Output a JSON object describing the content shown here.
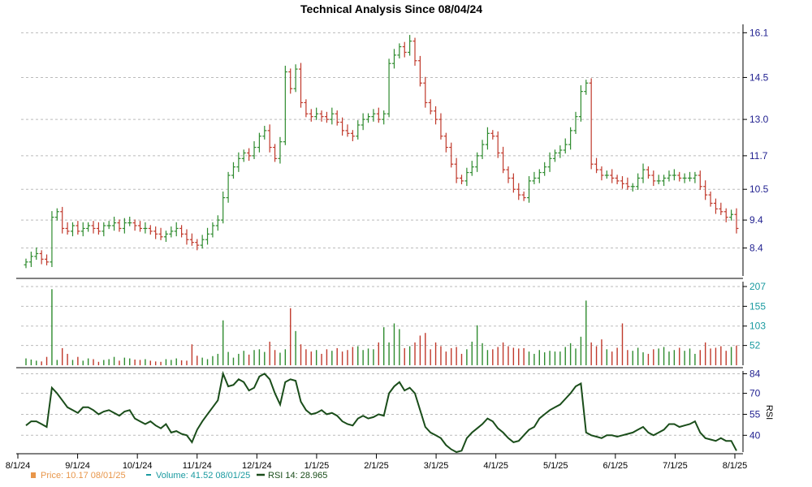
{
  "chart_data": {
    "type": "candlestick",
    "title": "Technical Analysis Since 08/04/24",
    "x_ticks": [
      "8/1/24",
      "9/1/24",
      "10/1/24",
      "11/1/24",
      "12/1/24",
      "1/1/25",
      "2/1/25",
      "3/1/25",
      "4/1/25",
      "5/1/25",
      "6/1/25",
      "7/1/25",
      "8/1/25"
    ],
    "price": {
      "yticks": [
        "16.1",
        "14.5",
        "13.0",
        "11.7",
        "10.5",
        "9.4",
        "8.4"
      ],
      "ylim": [
        7.4,
        16.4
      ],
      "close": [
        7.9,
        8.1,
        8.2,
        8.0,
        7.9,
        9.5,
        9.7,
        9.1,
        9.0,
        9.2,
        9.0,
        9.1,
        9.2,
        9.1,
        9.0,
        9.2,
        9.2,
        9.3,
        9.1,
        9.3,
        9.3,
        9.2,
        9.1,
        9.1,
        9.0,
        8.9,
        8.8,
        8.9,
        9.0,
        9.1,
        8.9,
        8.7,
        8.6,
        8.5,
        8.7,
        8.9,
        9.2,
        9.4,
        10.2,
        11.0,
        11.3,
        11.6,
        11.8,
        11.7,
        12.0,
        12.4,
        12.6,
        12.0,
        11.6,
        12.2,
        14.7,
        14.1,
        14.8,
        13.6,
        13.2,
        13.1,
        13.2,
        13.1,
        13.0,
        13.2,
        12.9,
        12.6,
        12.5,
        12.4,
        12.8,
        13.0,
        13.1,
        13.2,
        13.0,
        13.2,
        15.0,
        15.3,
        15.6,
        15.4,
        15.8,
        15.1,
        14.3,
        13.6,
        13.3,
        13.0,
        12.4,
        12.0,
        11.4,
        10.9,
        10.8,
        11.1,
        11.3,
        11.7,
        12.1,
        12.5,
        12.4,
        11.8,
        11.2,
        10.9,
        10.5,
        10.3,
        10.2,
        10.8,
        10.9,
        11.1,
        11.3,
        11.6,
        11.8,
        11.9,
        12.1,
        12.6,
        13.1,
        14.0,
        14.3,
        11.4,
        11.2,
        11.0,
        11.0,
        10.9,
        10.8,
        10.7,
        10.6,
        10.6,
        10.9,
        11.2,
        11.0,
        10.8,
        10.8,
        10.9,
        11.0,
        11.0,
        10.9,
        10.9,
        10.9,
        11.0,
        10.6,
        10.3,
        10.0,
        9.8,
        9.7,
        9.5,
        9.6,
        9.1
      ]
    },
    "volume": {
      "yticks": [
        "207",
        "155",
        "103",
        "52"
      ],
      "ylim": [
        0,
        207
      ],
      "values": [
        18,
        15,
        12,
        10,
        22,
        200,
        14,
        45,
        30,
        14,
        22,
        12,
        18,
        16,
        9,
        14,
        16,
        22,
        12,
        20,
        18,
        15,
        14,
        16,
        12,
        10,
        9,
        16,
        14,
        18,
        13,
        12,
        55,
        25,
        20,
        16,
        24,
        30,
        118,
        35,
        20,
        30,
        38,
        28,
        40,
        42,
        35,
        62,
        40,
        33,
        42,
        150,
        90,
        55,
        42,
        36,
        40,
        30,
        42,
        38,
        45,
        36,
        40,
        48,
        50,
        40,
        44,
        42,
        60,
        100,
        60,
        110,
        95,
        45,
        50,
        60,
        78,
        85,
        42,
        60,
        50,
        36,
        45,
        48,
        30,
        42,
        62,
        105,
        58,
        40,
        42,
        48,
        60,
        50,
        46,
        44,
        45,
        36,
        30,
        40,
        34,
        38,
        36,
        36,
        48,
        58,
        44,
        75,
        170,
        60,
        50,
        68,
        42,
        36,
        46,
        110,
        40,
        38,
        46,
        34,
        30,
        42,
        44,
        48,
        36,
        40,
        46,
        38,
        44,
        30,
        40,
        60,
        44,
        46,
        50,
        38,
        48,
        52
      ]
    },
    "rsi": {
      "yticks": [
        "84",
        "70",
        "55",
        "40"
      ],
      "ylim": [
        28,
        86
      ],
      "ylabel": "RSI",
      "values": [
        47,
        50,
        50,
        48,
        46,
        74,
        70,
        65,
        60,
        58,
        56,
        60,
        60,
        58,
        55,
        57,
        58,
        56,
        54,
        57,
        58,
        52,
        50,
        48,
        50,
        47,
        45,
        48,
        42,
        43,
        41,
        40,
        35,
        44,
        50,
        55,
        60,
        65,
        84,
        75,
        76,
        80,
        78,
        72,
        74,
        82,
        84,
        80,
        70,
        62,
        78,
        80,
        79,
        64,
        58,
        55,
        56,
        58,
        55,
        56,
        54,
        50,
        48,
        47,
        52,
        54,
        52,
        53,
        55,
        54,
        70,
        75,
        78,
        72,
        74,
        70,
        58,
        46,
        42,
        40,
        38,
        33,
        30,
        28,
        29,
        38,
        42,
        45,
        48,
        52,
        50,
        45,
        42,
        38,
        35,
        36,
        40,
        44,
        46,
        52,
        55,
        58,
        60,
        62,
        66,
        70,
        75,
        77,
        42,
        40,
        39,
        38,
        40,
        40,
        39,
        40,
        41,
        42,
        44,
        46,
        42,
        40,
        42,
        44,
        48,
        48,
        46,
        47,
        48,
        50,
        42,
        38,
        37,
        36,
        38,
        36,
        36,
        29
      ]
    },
    "legend": [
      {
        "label": "Price: 10.17  08/01/25",
        "color": "#e8964a",
        "symbol": "square"
      },
      {
        "label": "Volume: 41.52  08/01/25",
        "color": "#1a9aa0",
        "symbol": "dash"
      },
      {
        "label": "RSI 14: 28.965",
        "color": "#1a4d1a",
        "symbol": "line"
      }
    ],
    "colors": {
      "up": "#2e8b2e",
      "down": "#c0392b",
      "rsi_line": "#1a4d1a",
      "grid": "#bbbbbb",
      "axis": "#000000"
    }
  }
}
